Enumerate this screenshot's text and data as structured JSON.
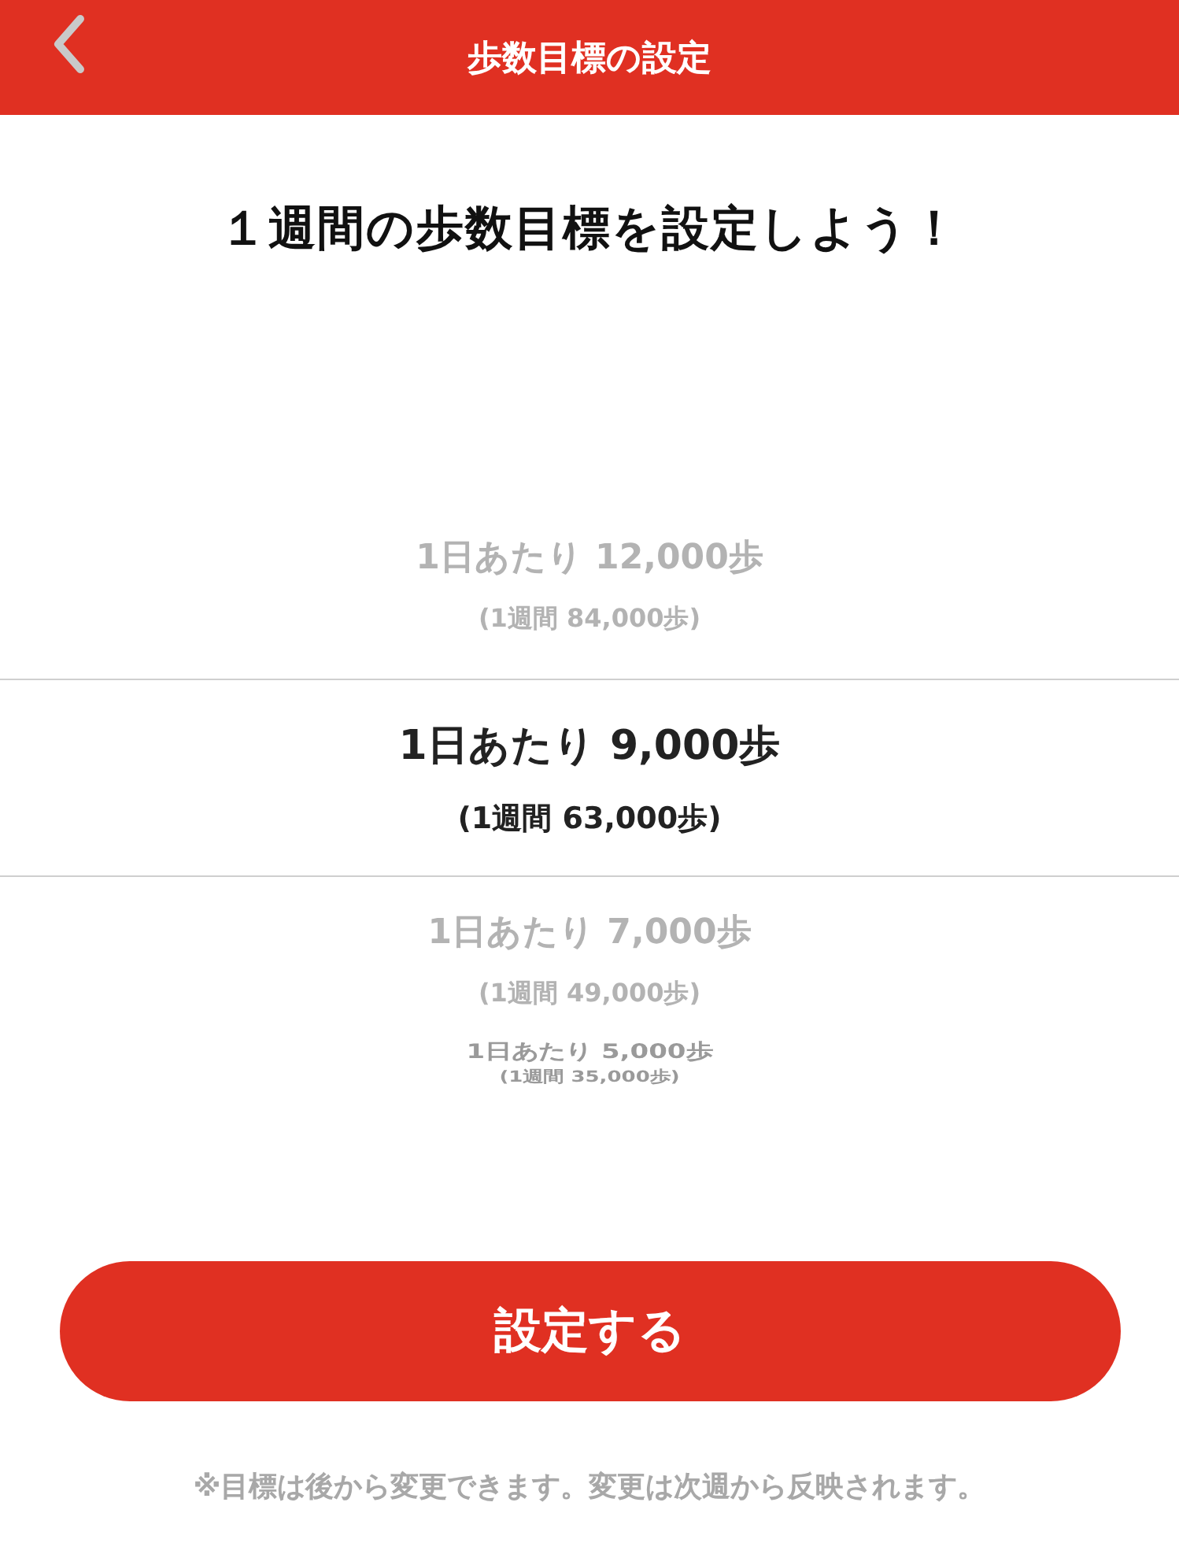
{
  "header": {
    "title": "歩数目標の設定"
  },
  "heading": "１週間の歩数目標を設定しよう！",
  "picker": {
    "options": [
      {
        "daily": "1日あたり 12,000歩",
        "weekly": "(1週間 84,000歩)",
        "selected": false
      },
      {
        "daily": "1日あたり 9,000歩",
        "weekly": "(1週間 63,000歩)",
        "selected": true
      },
      {
        "daily": "1日あたり 7,000歩",
        "weekly": "(1週間 49,000歩)",
        "selected": false
      },
      {
        "daily": "1日あたり 5,000歩",
        "weekly": "(1週間 35,000歩)",
        "selected": false
      }
    ]
  },
  "submit_button": "設定する",
  "note": "※目標は後から変更できます。変更は次週から反映されます。"
}
